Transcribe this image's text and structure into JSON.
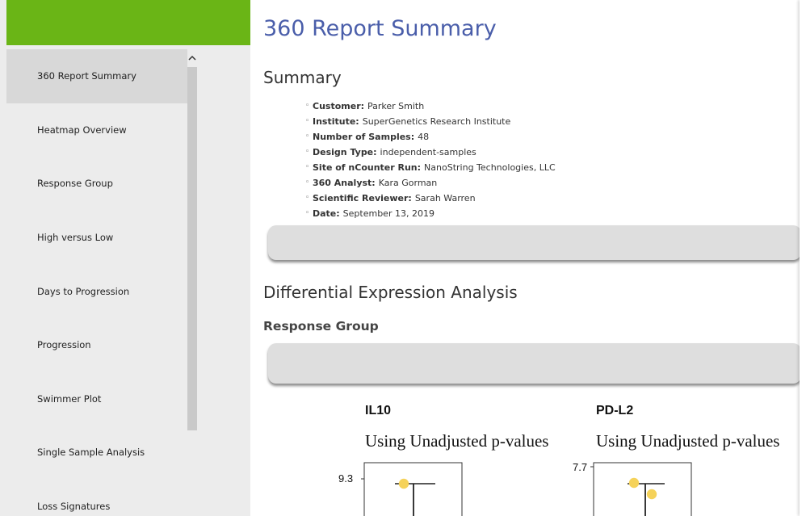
{
  "sidebar": {
    "brand_color": "#6ab516",
    "items": [
      {
        "label": "360 Report Summary",
        "active": true
      },
      {
        "label": "Heatmap Overview"
      },
      {
        "label": "Response Group"
      },
      {
        "label": "High versus Low"
      },
      {
        "label": "Days to Progression"
      },
      {
        "label": "Progression"
      },
      {
        "label": "Swimmer Plot"
      },
      {
        "label": "Single Sample Analysis"
      },
      {
        "label": "Loss Signatures"
      }
    ]
  },
  "main": {
    "title": "360 Report Summary",
    "summary_heading": "Summary",
    "summary_items": [
      {
        "label": "Customer:",
        "value": "Parker Smith"
      },
      {
        "label": "Institute:",
        "value": "SuperGenetics Research Institute"
      },
      {
        "label": "Number of Samples:",
        "value": "48"
      },
      {
        "label": "Design Type:",
        "value": "independent-samples"
      },
      {
        "label": "Site of nCounter Run:",
        "value": "NanoString Technologies, LLC"
      },
      {
        "label": "360 Analyst:",
        "value": "Kara Gorman"
      },
      {
        "label": "Scientific Reviewer:",
        "value": "Sarah Warren"
      },
      {
        "label": "Date:",
        "value": "September 13, 2019"
      }
    ],
    "dea_heading": "Differential Expression Analysis",
    "response_group_heading": "Response Group",
    "plots": [
      {
        "title": "IL10",
        "subtitle": "Using Unadjusted p-values",
        "y_top_tick": "9.3",
        "point_color": "#f5d25a"
      },
      {
        "title": "PD-L2",
        "subtitle": "Using Unadjusted p-values",
        "y_top_tick": "7.7",
        "point_color": "#f5d25a"
      }
    ]
  }
}
